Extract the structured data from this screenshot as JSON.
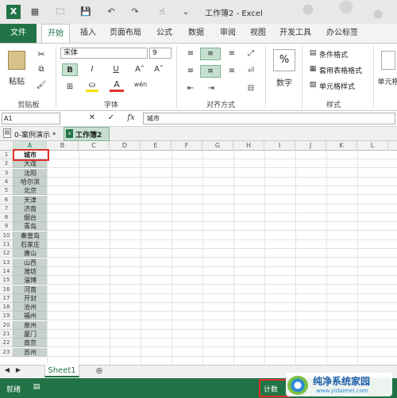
{
  "window": {
    "title": "工作簿2 - Excel"
  },
  "tabs": {
    "file": "文件",
    "items": [
      "开始",
      "插入",
      "页面布局",
      "公式",
      "数据",
      "审阅",
      "视图",
      "开发工具",
      "办公标签"
    ],
    "active": "开始"
  },
  "ribbon": {
    "clipboard": {
      "paste": "粘贴",
      "group": "剪贴板"
    },
    "font": {
      "name": "宋体",
      "size": "9",
      "bold": "B",
      "italic": "I",
      "underline": "U",
      "font_color": "A",
      "group": "字体"
    },
    "alignment": {
      "group": "对齐方式"
    },
    "number": {
      "label": "数字",
      "symbol": "%"
    },
    "styles": {
      "conditional": "条件格式",
      "table": "套用表格格式",
      "cell": "单元格样式",
      "group": "样式"
    },
    "cells": {
      "label": "单元格"
    }
  },
  "formula_bar": {
    "name_box": "A1",
    "fx": "fx",
    "content": "城市"
  },
  "workbook_tabs": [
    {
      "label": "0-案例演示 *",
      "active": false
    },
    {
      "label": "工作簿2",
      "active": true
    }
  ],
  "columns": [
    "A",
    "B",
    "C",
    "D",
    "E",
    "F",
    "G",
    "H",
    "I",
    "J",
    "K",
    "L"
  ],
  "rows": [
    "1",
    "2",
    "3",
    "4",
    "5",
    "6",
    "7",
    "8",
    "9",
    "10",
    "11",
    "12",
    "13",
    "14",
    "15",
    "16",
    "17",
    "18",
    "19",
    "20",
    "21",
    "22",
    "23"
  ],
  "column_a": [
    "城市",
    "大连",
    "沈阳",
    "哈尔滨",
    "北京",
    "天津",
    "济南",
    "烟台",
    "青岛",
    "秦皇岛",
    "石家庄",
    "唐山",
    "山西",
    "潍坊",
    "淄博",
    "河南",
    "开封",
    "沧州",
    "福州",
    "泉州",
    "厦门",
    "南京",
    "苏州"
  ],
  "sheet": {
    "name": "Sheet1",
    "add": "⊕"
  },
  "status": {
    "mode": "就绪",
    "count_label": "计数",
    "watermark_main": "纯净系统家园",
    "watermark_url": "www.yidaimei.com"
  },
  "colors": {
    "brand": "#217346",
    "selection": "#c8d2cc",
    "highlight": "#e0302a"
  }
}
